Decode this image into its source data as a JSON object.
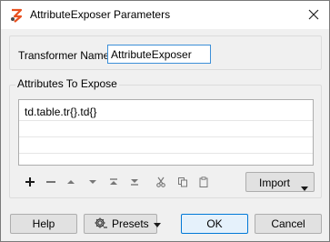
{
  "window": {
    "title": "AttributeExposer Parameters",
    "app_icon": "fme-transformer-icon",
    "close_icon": "close-icon"
  },
  "transformer_name": {
    "label": "Transformer Name:",
    "value": "AttributeExposer"
  },
  "attributes_group": {
    "legend": "Attributes To Expose",
    "rows": [
      "td.table.tr{}.td{}",
      "",
      "",
      ""
    ]
  },
  "toolbar": {
    "icons": [
      "add-icon",
      "remove-icon",
      "move-up-icon",
      "move-down-icon",
      "move-to-top-icon",
      "move-to-bottom-icon",
      "cut-icon",
      "copy-icon",
      "paste-icon"
    ],
    "import_label": "Import"
  },
  "footer": {
    "help_label": "Help",
    "presets_label": "Presets",
    "ok_label": "OK",
    "cancel_label": "Cancel"
  },
  "colors": {
    "focus_border": "#3c8fd8",
    "default_button_border": "#0078d7",
    "background": "#f0f0f0"
  }
}
